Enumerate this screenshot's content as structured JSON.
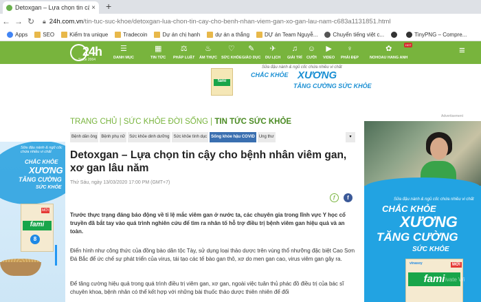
{
  "browser": {
    "tab_title": "Detoxgan – Lựa chọn tin cậy cho",
    "tab_close": "×",
    "new_tab": "+",
    "url_domain": "24h.com.vn",
    "url_path": "/tin-tuc-suc-khoe/detoxgan-lua-chon-tin-cay-cho-benh-nhan-viem-gan-xo-gan-lau-nam-c683a1131851.html",
    "bookmarks": [
      {
        "label": "Apps",
        "icon": "apps-icon",
        "color": "#4285f4"
      },
      {
        "label": "SEO",
        "icon": "folder-icon",
        "color": "#e8b84a"
      },
      {
        "label": "Kiểm tra unique",
        "icon": "folder-icon",
        "color": "#e8b84a"
      },
      {
        "label": "Tradecoin",
        "icon": "folder-icon",
        "color": "#e8b84a"
      },
      {
        "label": "Dự án chị hạnh",
        "icon": "folder-icon",
        "color": "#e8b84a"
      },
      {
        "label": "dự án a thắng",
        "icon": "folder-icon",
        "color": "#e8b84a"
      },
      {
        "label": "DỰ án Team Nguyễ...",
        "icon": "folder-icon",
        "color": "#e8b84a"
      },
      {
        "label": "Chuyển tiếng việt c...",
        "icon": "sync-icon",
        "color": "#555555"
      },
      {
        "label": "",
        "icon": "globe-icon",
        "color": "#333333"
      },
      {
        "label": "TinyPNG – Compre...",
        "icon": "panda-icon",
        "color": "#333333"
      }
    ]
  },
  "site": {
    "logo_text": "24h",
    "logo_since": "Since 2004",
    "menu": [
      {
        "label": "DANH MỤC",
        "icon": "☰"
      },
      {
        "label": "TIN TỨC",
        "icon": "▦"
      },
      {
        "label": "PHÁP LUẬT",
        "icon": "⚖"
      },
      {
        "label": "ẨM THỰC",
        "icon": "♨"
      },
      {
        "label": "SỨC KHỎE",
        "icon": "♡"
      },
      {
        "label": "GIÁO DỤC",
        "icon": "✎"
      },
      {
        "label": "DU LỊCH",
        "icon": "✈"
      },
      {
        "label": "GIẢI TRÍ",
        "icon": "♫"
      },
      {
        "label": "CƯỜI",
        "icon": "☺"
      },
      {
        "label": "VIDEO",
        "icon": "▶"
      },
      {
        "label": "PHÁI ĐẸP",
        "icon": "♀"
      },
      {
        "label": "NOHOAU HANG ANH",
        "icon": "✿"
      }
    ],
    "hot_badge": "HOT",
    "right_menu_icon": "≡",
    "theme_color": "#78b43d"
  },
  "top_banner": {
    "small": "Sữa đậu nành & ngũ cốc chứa nhiều vi chất",
    "line1": "CHẮC KHỎE",
    "line2": "XƯƠNG",
    "line3": "TĂNG CƯỜNG SỨC KHỎE",
    "brand": "fami"
  },
  "ad_label": "Advertisement",
  "left_ad": {
    "small": "Sữa đậu nành & ngũ cốc chứa nhiều vi chất",
    "line1": "CHẮC KHỎE",
    "line2": "XƯƠNG",
    "line3": "TĂNG CƯỜNG",
    "line4": "SỨC KHỎE",
    "brand": "fami",
    "badge": "MỚI",
    "number": "8"
  },
  "article": {
    "breadcrumb": {
      "home": "TRANG CHỦ",
      "section": "SỨC KHỎE ĐỜI SỐNG",
      "current": "TIN TỨC SỨC KHỎE"
    },
    "subnav": [
      {
        "label": "Bệnh dân ông",
        "active": false
      },
      {
        "label": "Bệnh phụ nữ",
        "active": false
      },
      {
        "label": "Sức khỏe dinh dưỡng",
        "active": false
      },
      {
        "label": "Sức khỏe tình dục",
        "active": false
      },
      {
        "label": "Sống khỏe hậu COVID",
        "active": true
      },
      {
        "label": "Ung thư",
        "active": false
      }
    ],
    "subnav_more": "▾",
    "title": "Detoxgan – Lựa chọn tin cậy cho bệnh nhân viêm gan, xơ gan lâu năm",
    "date": "Thứ Sáu, ngày 13/03/2020 17:00 PM (GMT+7)",
    "share_gf": "ƒ",
    "share_fb": "f",
    "paragraphs": [
      "Trước thực trạng đáng báo động về tỉ lệ mắc viêm gan ở nước ta, các chuyên gia trong lĩnh vực Y học cổ truyền đã bắt tay vào quá trình nghiên cứu để tìm ra nhân tố hỗ trợ điều trị bệnh viêm gan hiệu quả và an toàn.",
      "Điển hình như công thức của đồng bào dân tộc Tày, sử dụng loại thảo dược trên vùng thổ nhưỡng đặc biệt Cao Sơn Đá Bắc để ức chế sự phát triển của virus, tái tạo các tế bào gan thô, xơ do men gan cao, virus viêm gan gây ra.",
      "Để tăng cường hiệu quả trong quá trình điều trị viêm gan, xơ gan, ngoài việc tuân thủ phác đồ điều trị của bác sĩ chuyên khoa, bệnh nhân có thể kết hợp với những bài thuốc thảo dược thiên nhiên để đổi"
    ]
  },
  "right_ad": {
    "small": "Sữa đậu nành & ngũ cốc chứa nhiều vi chất",
    "line1": "CHẮC KHỎE",
    "line2": "XƯƠNG",
    "line3": "TĂNG CƯỜNG",
    "line4": "SỨC KHỎE",
    "brand_small": "vinasoy",
    "brand": "fami",
    "badge": "MỚI",
    "watermark": "ivate Wi"
  }
}
